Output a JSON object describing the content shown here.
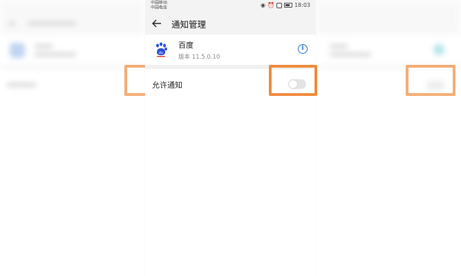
{
  "status": {
    "carrier1": "中国移动",
    "carrier2": "中国电信",
    "time": "18:03"
  },
  "header": {
    "title": "通知管理"
  },
  "app": {
    "name": "百度",
    "version": "版本 11.5.0.10"
  },
  "setting": {
    "label": "允许通知",
    "enabled": false
  },
  "colors": {
    "highlight": "#ef8a3c",
    "accent": "#1d6fd6"
  },
  "icons": {
    "back": "back-arrow-icon",
    "info": "info-icon",
    "app": "baidu-paw-icon"
  }
}
